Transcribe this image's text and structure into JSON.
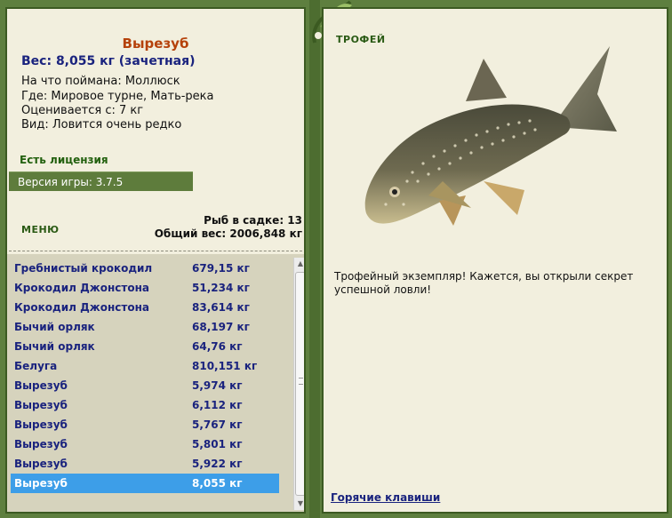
{
  "fish": {
    "name": "Вырезуб",
    "weight_line": "Вес: 8,055 кг (зачетная)",
    "bait": "На что поймана: Моллюск",
    "where": "Где: Мировое турне, Мать-река",
    "price": "Оценивается с: 7 кг",
    "kind": "Вид: Ловится очень редко"
  },
  "license": "Есть лицензия",
  "version": "Версия игры: 3.7.5",
  "menu_label": "МЕНЮ",
  "stats": {
    "count": "Рыб в садке: 13",
    "total_weight": "Общий вес: 2006,848 кг"
  },
  "catch_list": [
    {
      "name": "Гребнистый крокодил",
      "weight": "679,15 кг"
    },
    {
      "name": "Крокодил Джонстона",
      "weight": "51,234 кг"
    },
    {
      "name": "Крокодил Джонстона",
      "weight": "83,614 кг"
    },
    {
      "name": "Бычий орляк",
      "weight": "68,197 кг"
    },
    {
      "name": "Бычий орляк",
      "weight": "64,76 кг"
    },
    {
      "name": "Белуга",
      "weight": "810,151 кг"
    },
    {
      "name": "Вырезуб",
      "weight": "5,974 кг"
    },
    {
      "name": "Вырезуб",
      "weight": "6,112 кг"
    },
    {
      "name": "Вырезуб",
      "weight": "5,767 кг"
    },
    {
      "name": "Вырезуб",
      "weight": "5,801 кг"
    },
    {
      "name": "Вырезуб",
      "weight": "5,922 кг"
    },
    {
      "name": "Вырезуб",
      "weight": "8,055 кг"
    }
  ],
  "selected_index": 11,
  "trophy": {
    "title": "ТРОФЕЙ",
    "text": "Трофейный экземпляр! Кажется, вы открыли секрет успешной ловли!"
  },
  "hotkeys": "Горячие клавиши",
  "colors": {
    "background": "#5e7f3f",
    "panel": "#f2efde",
    "list_bg": "#d6d3bd",
    "selection": "#3d9ee8",
    "fish_name": "#b5410a",
    "list_text": "#1a237e"
  }
}
